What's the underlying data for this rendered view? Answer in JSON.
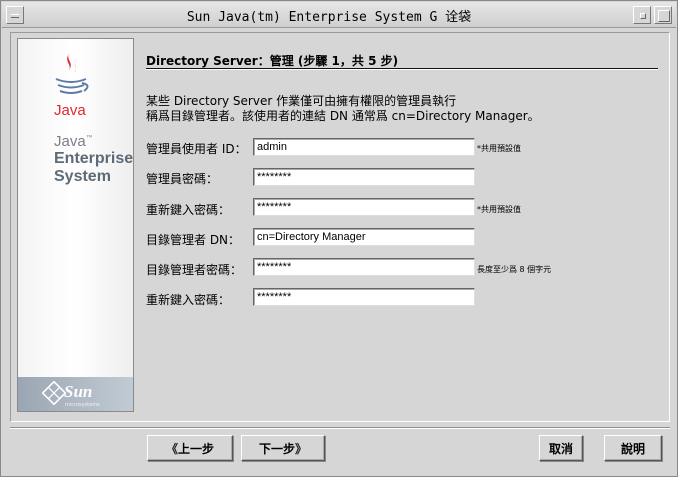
{
  "window": {
    "title": "Sun Java(tm) Enterprise System G  诠袋"
  },
  "banner": {
    "java_logo_text": "Java",
    "java_text": "Java",
    "tm": "™",
    "enterprise": "Enterprise",
    "system": "System",
    "sun_logo": "Sun",
    "sun_sub": "microsystems"
  },
  "page": {
    "heading": "Directory Server：管理 (步驟 1，共 5 步)",
    "description_line1": "某些 Directory Server 作業僅可由擁有權限的管理員執行",
    "description_line2": "稱爲目錄管理者。該使用者的連結 DN 通常爲 cn=Directory Manager。"
  },
  "form": {
    "admin_user_id": {
      "label": "管理員使用者 ID：",
      "value": "admin",
      "note": "*共用預設值"
    },
    "admin_password": {
      "label": "管理員密碼：",
      "value": "********"
    },
    "admin_password_confirm": {
      "label": "重新鍵入密碼：",
      "value": "********",
      "note": "*共用預設值"
    },
    "directory_manager_dn": {
      "label": "目錄管理者 DN：",
      "value": "cn=Directory Manager"
    },
    "directory_manager_password": {
      "label": "目錄管理者密碼：",
      "value": "********",
      "note": "長度至少爲 8 個字元"
    },
    "directory_manager_password_confirm": {
      "label": "重新鍵入密碼：",
      "value": "********"
    }
  },
  "buttons": {
    "back": "上一步",
    "next": "下一步",
    "cancel": "取消",
    "help": "說明",
    "back_arrow": "《",
    "next_arrow": "》"
  }
}
